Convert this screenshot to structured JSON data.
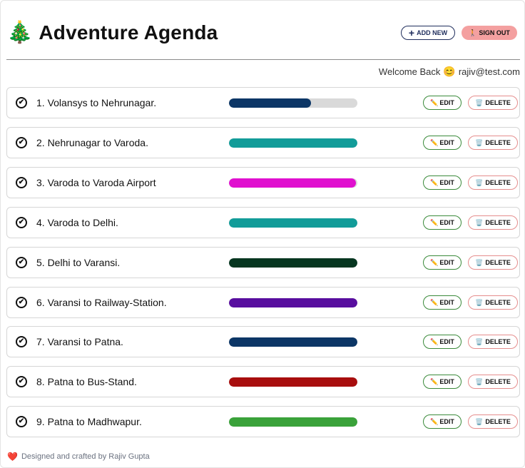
{
  "app": {
    "title": "Adventure Agenda",
    "brand_icon": "🎄"
  },
  "header": {
    "add_new_label": "ADD NEW",
    "add_new_icon": "+",
    "sign_out_label": "SIGN OUT",
    "sign_out_icon": "🚶"
  },
  "welcome": {
    "text": "Welcome Back",
    "emoji": "😊",
    "email": "rajiv@test.com"
  },
  "actions": {
    "edit_label": "EDIT",
    "edit_icon": "✏️",
    "delete_label": "DELETE",
    "delete_icon": "🗑️"
  },
  "items": [
    {
      "title": "1. Volansys to Nehrunagar.",
      "progress": 0.64,
      "color": "#0c3666"
    },
    {
      "title": "2. Nehrunagar to Varoda.",
      "progress": 1.0,
      "color": "#129c99"
    },
    {
      "title": "3. Varoda to Varoda Airport",
      "progress": 0.99,
      "color": "#e010cf"
    },
    {
      "title": "4. Varoda to Delhi.",
      "progress": 1.0,
      "color": "#129c99"
    },
    {
      "title": "5. Delhi to Varansi.",
      "progress": 1.0,
      "color": "#063620"
    },
    {
      "title": "6. Varansi to Railway-Station.",
      "progress": 1.0,
      "color": "#580e9f"
    },
    {
      "title": "7. Varansi to Patna.",
      "progress": 1.0,
      "color": "#0c3666"
    },
    {
      "title": "8. Patna to Bus-Stand.",
      "progress": 1.0,
      "color": "#a80e0e"
    },
    {
      "title": "9. Patna to Madhwapur.",
      "progress": 1.0,
      "color": "#3aa23a"
    }
  ],
  "footer": {
    "heart": "❤️",
    "text": "Designed and crafted by Rajiv Gupta"
  }
}
